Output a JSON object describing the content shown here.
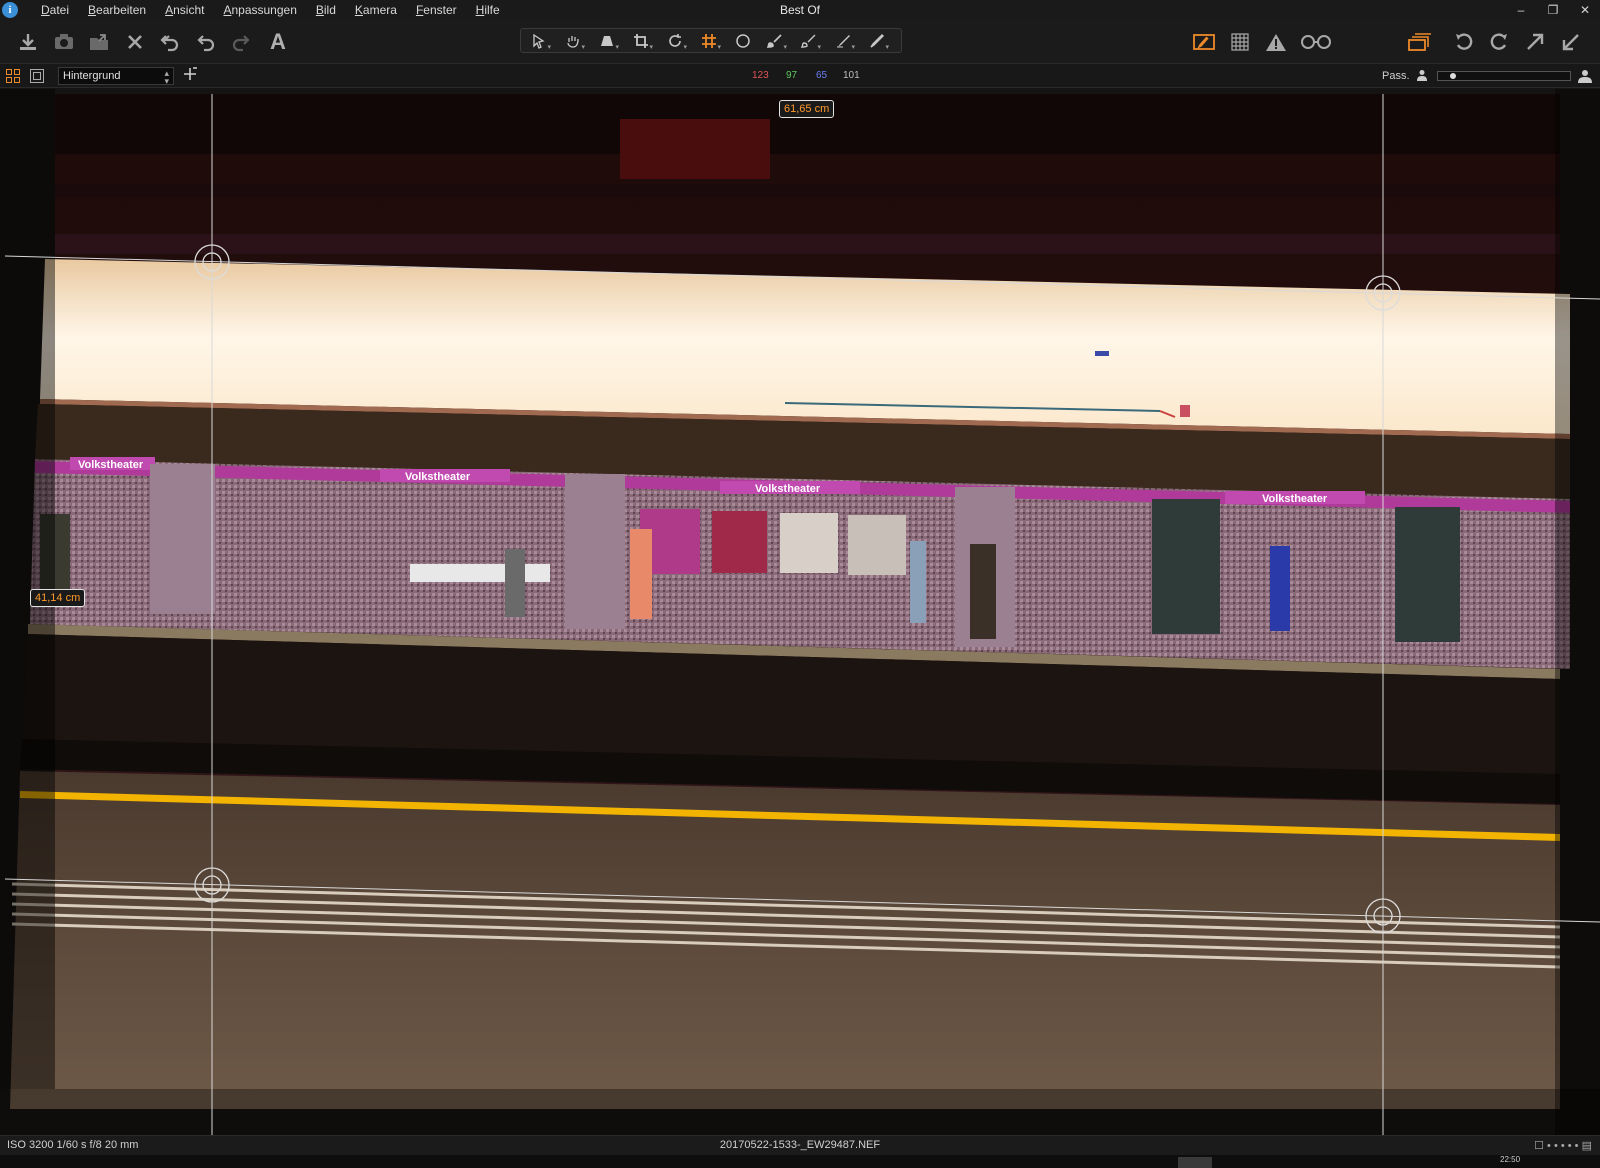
{
  "app": {
    "logo": "i",
    "title": "Best Of"
  },
  "menu": [
    "Datei",
    "Bearbeiten",
    "Ansicht",
    "Anpassungen",
    "Bild",
    "Kamera",
    "Fenster",
    "Hilfe"
  ],
  "window_controls": {
    "minimize": "–",
    "restore": "❐",
    "close": "✕"
  },
  "toolbar": {
    "left_icons": [
      "import-icon",
      "camera-icon",
      "export-icon",
      "delete-icon",
      "undo-all-icon",
      "undo-icon",
      "redo-icon",
      "text-icon"
    ],
    "text_tool_label": "A",
    "cursor_tools": [
      "select-icon",
      "pan-icon",
      "keystone-icon",
      "crop-icon",
      "rotate-icon",
      "grid-icon",
      "circle-icon",
      "brush-icon",
      "erase-icon",
      "gradient-icon",
      "pen-icon"
    ],
    "right_icons": [
      "edit-mask-icon",
      "grid-overlay-icon",
      "warning-icon",
      "glasses-icon",
      "layers-icon",
      "rotate-left-icon",
      "rotate-right-icon",
      "expand-icon",
      "collapse-icon"
    ],
    "accent_color": "#ee8a2a"
  },
  "subbar": {
    "layer_select": "Hintergrund",
    "rgb_readout": {
      "r": "123",
      "g": "97",
      "b": "65",
      "l": "101"
    },
    "rgb_colors": {
      "r": "#e05555",
      "g": "#5ec95e",
      "b": "#6b7ff0",
      "l": "#bdbdbd"
    },
    "pass_label": "Pass.",
    "zoom_level": 0.1
  },
  "viewer": {
    "measure_horizontal": "61,65 cm",
    "measure_vertical": "41,14 cm",
    "station_signs": [
      "Volkstheater",
      "Volkstheater",
      "Volkstheater",
      "Volkstheater"
    ]
  },
  "statusbar": {
    "exif": "ISO 3200 1/60 s f/8 20 mm",
    "filename": "20170522-1533-_EW29487.NEF",
    "right_icons": "☐ • • • • • ▤"
  },
  "bottom": {
    "clock": "22:50"
  }
}
